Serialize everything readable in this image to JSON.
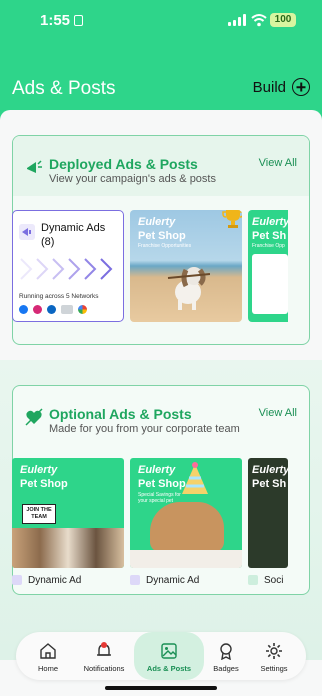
{
  "status_bar": {
    "time": "1:55",
    "battery": "100"
  },
  "header": {
    "title": "Ads & Posts",
    "build_label": "Build"
  },
  "deployed": {
    "title": "Deployed Ads & Posts",
    "subtitle": "View your campaign's ads & posts",
    "view_all": "View All",
    "dynamic_card": {
      "title": "Dynamic Ads",
      "count": "(8)",
      "running": "Running across 5 Networks",
      "networks": [
        "facebook-icon",
        "instagram-icon",
        "linkedin-icon",
        "bing-icon",
        "google-icon"
      ]
    },
    "items": [
      {
        "brand": "Eulerty",
        "sub": "Pet Shop",
        "tagline": "Franchise Opportunities"
      },
      {
        "brand": "Eulerty",
        "sub": "Pet Sh",
        "tagline": "Franchise Opp"
      }
    ]
  },
  "optional": {
    "title": "Optional Ads & Posts",
    "subtitle": "Made for you from your corporate team",
    "view_all": "View All",
    "items": [
      {
        "brand": "Eulerty",
        "sub": "Pet Shop",
        "tagline": "Join the team",
        "label": "Dynamic Ad"
      },
      {
        "brand": "Eulerty",
        "sub": "Pet Shop",
        "tagline": "Special Savings for your special pet",
        "label": "Dynamic Ad"
      },
      {
        "brand": "Eulerty",
        "sub": "Pet Sh",
        "tagline": "",
        "label": "Soci"
      }
    ]
  },
  "tabs": [
    {
      "label": "Home",
      "icon": "home-icon"
    },
    {
      "label": "Notifications",
      "icon": "bell-icon"
    },
    {
      "label": "Ads & Posts",
      "icon": "image-icon",
      "active": true
    },
    {
      "label": "Badges",
      "icon": "badge-icon"
    },
    {
      "label": "Settings",
      "icon": "gear-icon"
    }
  ],
  "colors": {
    "brand_green": "#2ed58a",
    "accent_green": "#1fa65f",
    "purple": "#7b6ee0"
  }
}
